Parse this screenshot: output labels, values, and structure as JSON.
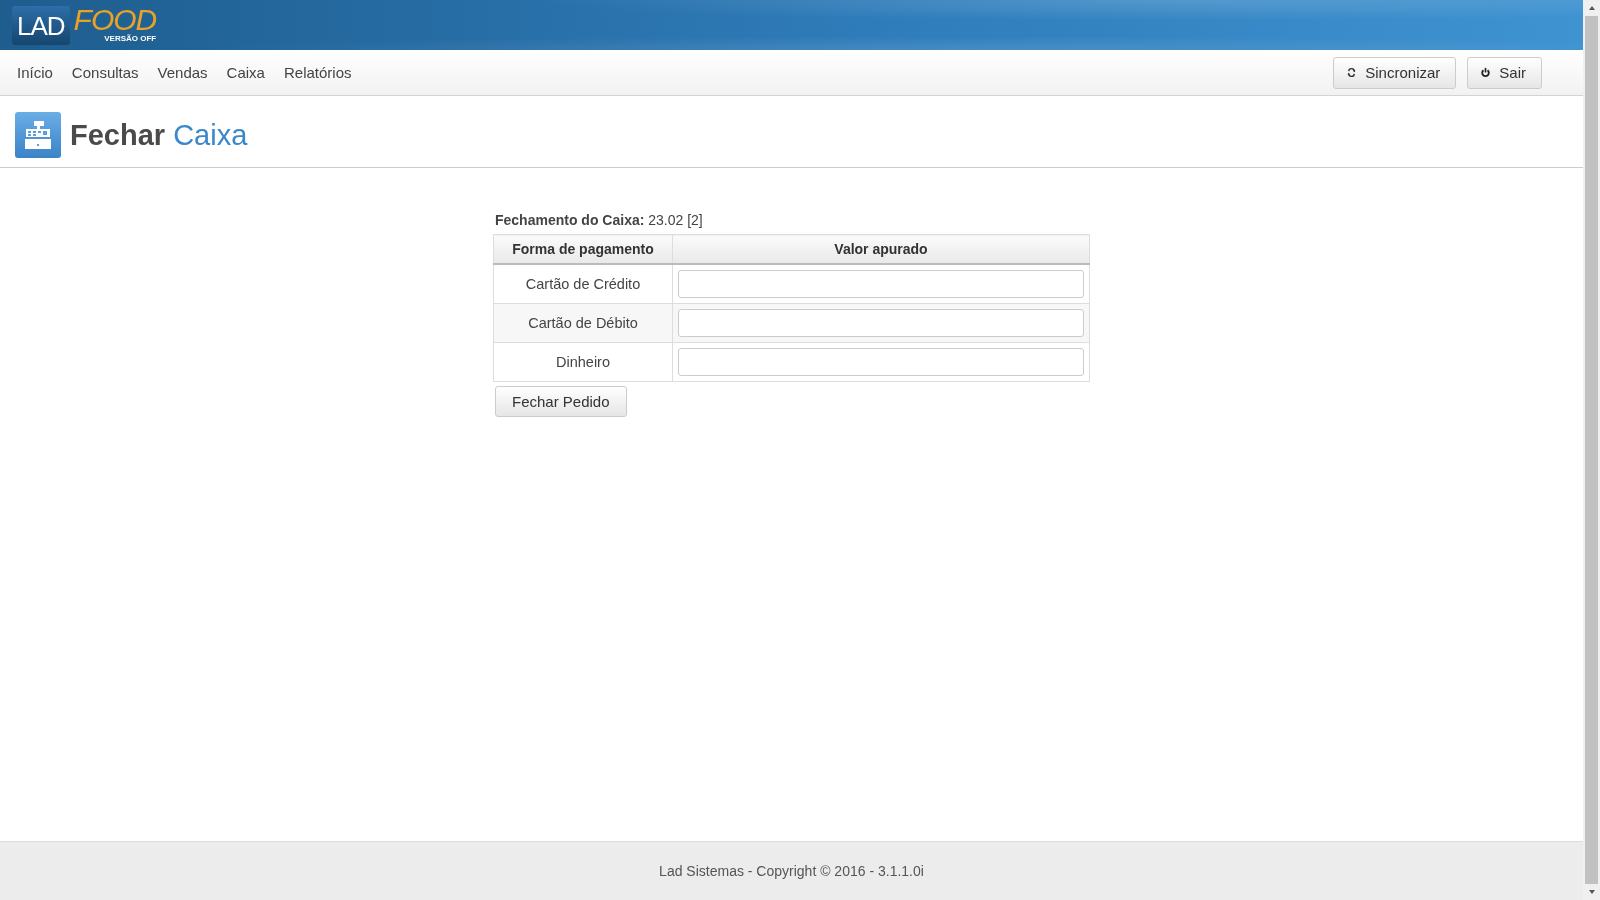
{
  "logo": {
    "brand": "LAD",
    "product": "FOOD",
    "edition": "VERSÃO OFF"
  },
  "nav": {
    "items": [
      {
        "label": "Início"
      },
      {
        "label": "Consultas"
      },
      {
        "label": "Vendas"
      },
      {
        "label": "Caixa"
      },
      {
        "label": "Relatórios"
      }
    ],
    "buttons": [
      {
        "label": "Sincronizar",
        "kind": "sync"
      },
      {
        "label": "Sair",
        "kind": "power"
      }
    ]
  },
  "page_title": {
    "main": "Fechar",
    "accent": "Caixa"
  },
  "form": {
    "caption": "**Fechamento do Caixa:** 23.02 [2]",
    "columns": [
      "Forma de pagamento",
      "Valor apurado"
    ],
    "rows": [
      {
        "method": "Cartão de Crédito"
      },
      {
        "method": "Cartão de Débito"
      },
      {
        "method": "Dinheiro"
      }
    ],
    "submit": "Fechar Pedido"
  },
  "footer": "Lad Sistemas - Copyright © 2016 - 3.1.1.0i"
}
